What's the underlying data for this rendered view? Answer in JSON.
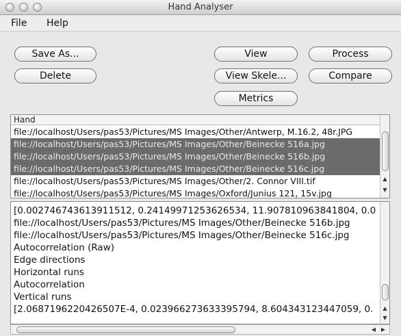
{
  "window": {
    "title": "Hand Analyser"
  },
  "menu": {
    "file": "File",
    "help": "Help"
  },
  "buttons": {
    "save_as": "Save As...",
    "delete": "Delete",
    "view": "View",
    "view_skeleton": "View Skele...",
    "metrics": "Metrics",
    "process": "Process",
    "compare": "Compare"
  },
  "file_list": {
    "header": "Hand",
    "rows": [
      {
        "text": "file://localhost/Users/pas53/Pictures/MS Images/Other/Antwerp, M.16.2, 48r.JPG",
        "selected": false
      },
      {
        "text": "file://localhost/Users/pas53/Pictures/MS Images/Other/Beinecke 516a.jpg",
        "selected": true
      },
      {
        "text": "file://localhost/Users/pas53/Pictures/MS Images/Other/Beinecke 516b.jpg",
        "selected": true
      },
      {
        "text": "file://localhost/Users/pas53/Pictures/MS Images/Other/Beinecke 516c.jpg",
        "selected": true
      },
      {
        "text": "file://localhost/Users/pas53/Pictures/MS Images/Other/2. Connor VIII.tif",
        "selected": false
      },
      {
        "text": "file://localhost/Users/pas53/Pictures/MS Images/Oxford/Junius 121, 15v.jpg",
        "selected": false
      }
    ]
  },
  "output_lines": [
    "[0.002746743613911512, 0.24149971253626534, 11.907810963841804, 0.0",
    "file://localhost/Users/pas53/Pictures/MS Images/Other/Beinecke 516b.jpg",
    "file://localhost/Users/pas53/Pictures/MS Images/Other/Beinecke 516c.jpg",
    "Autocorrelation (Raw)",
    "Edge directions",
    "Horizontal runs",
    "Autocorrelation",
    "Vertical runs",
    "[2.0687196220426507E-4, 0.023966273633395794, 8.604343123447059, 0."
  ],
  "icons": {
    "close": "traffic-light-close",
    "minimize": "traffic-light-minimize",
    "zoom": "traffic-light-zoom",
    "up": "▲",
    "down": "▼",
    "left": "◀",
    "right": "▶"
  }
}
